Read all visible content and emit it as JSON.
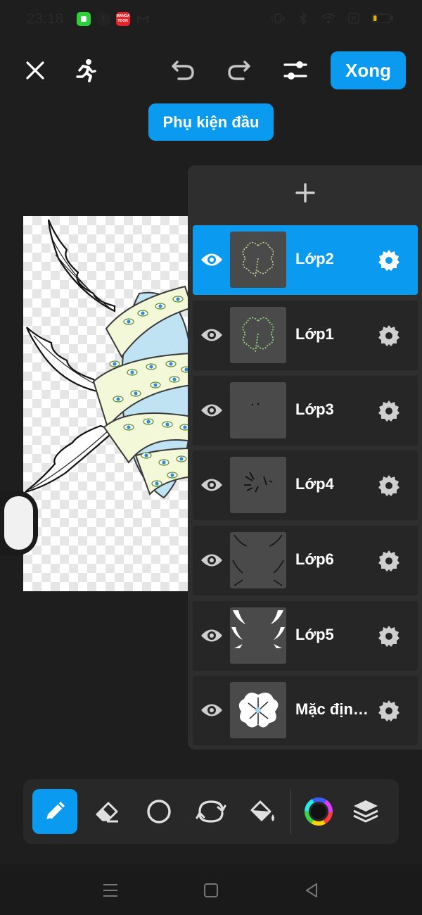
{
  "status_bar": {
    "time": "23:18",
    "apps": [
      {
        "name": "line-app-icon",
        "color": "#2bd13a"
      },
      {
        "name": "facebook-app-icon",
        "color": "#1e1e1e"
      },
      {
        "name": "mangatoon-app-icon",
        "color": "#e5242b",
        "label": "MANGA TOON"
      },
      {
        "name": "gmail-app-icon",
        "color": "#1e1e1e"
      }
    ],
    "battery_level": 0.2
  },
  "toolbar": {
    "done_label": "Xong"
  },
  "category_chip": {
    "label": "Phụ kiện đầu"
  },
  "layers": [
    {
      "name": "Lớp2",
      "active": true,
      "visible": true
    },
    {
      "name": "Lớp1",
      "active": false,
      "visible": true
    },
    {
      "name": "Lớp3",
      "active": false,
      "visible": true
    },
    {
      "name": "Lớp4",
      "active": false,
      "visible": true
    },
    {
      "name": "Lớp6",
      "active": false,
      "visible": true
    },
    {
      "name": "Lớp5",
      "active": false,
      "visible": true
    },
    {
      "name": "Mặc định...",
      "active": false,
      "visible": true
    }
  ],
  "tools": [
    {
      "name": "pencil-icon",
      "active": true
    },
    {
      "name": "eraser-icon",
      "active": false
    },
    {
      "name": "circle-shape-icon",
      "active": false
    },
    {
      "name": "lasso-transform-icon",
      "active": false
    },
    {
      "name": "paint-bucket-icon",
      "active": false
    },
    {
      "name": "color-wheel-icon",
      "active": false
    },
    {
      "name": "layers-stack-icon",
      "active": false
    }
  ],
  "colors": {
    "accent": "#0a9bf0",
    "panel": "#2e2e2e",
    "row": "#262626"
  }
}
